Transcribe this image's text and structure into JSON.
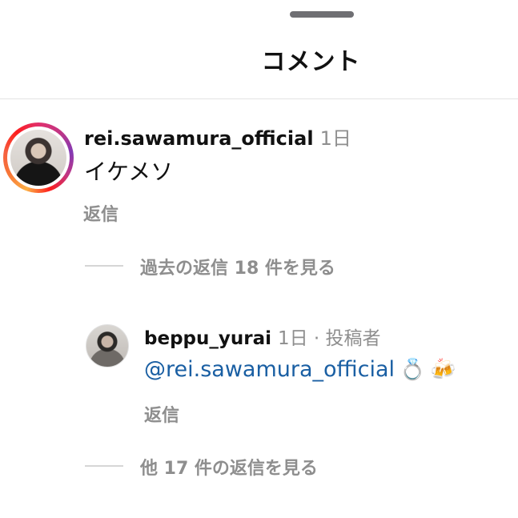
{
  "header": {
    "title": "コメント"
  },
  "comment": {
    "username": "rei.sawamura_official",
    "time": "1日",
    "text": "イケメソ",
    "reply_label": "返信",
    "view_previous_replies": "過去の返信 18 件を見る"
  },
  "reply": {
    "username": "beppu_yurai",
    "meta": "1日 · 投稿者",
    "mention": "@rei.sawamura_official",
    "emojis": [
      "💍",
      "🍻"
    ],
    "reply_label": "返信",
    "view_more_replies": "他 17 件の返信を見る"
  }
}
